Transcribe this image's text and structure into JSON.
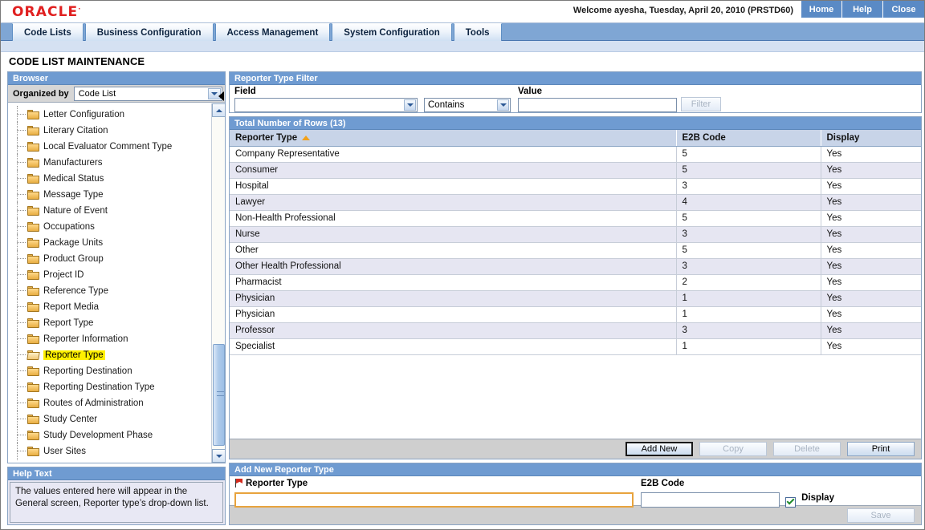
{
  "branding": {
    "logo_text": "ORACLE",
    "trademark": "·"
  },
  "header": {
    "welcome": "Welcome ayesha, Tuesday, April 20, 2010 (PRSTD60)",
    "nav_buttons": [
      {
        "label": "Home",
        "name": "home-link"
      },
      {
        "label": "Help",
        "name": "help-link"
      },
      {
        "label": "Close",
        "name": "close-link"
      }
    ]
  },
  "tabs": [
    {
      "label": "Code Lists",
      "active": true
    },
    {
      "label": "Business Configuration",
      "active": false
    },
    {
      "label": "Access Management",
      "active": false
    },
    {
      "label": "System Configuration",
      "active": false
    },
    {
      "label": "Tools",
      "active": false
    }
  ],
  "page_title": "CODE LIST MAINTENANCE",
  "browser": {
    "panel_title": "Browser",
    "organized_by_label": "Organized by",
    "organized_by_value": "Code List",
    "tree_items": [
      {
        "label": "Letter Configuration",
        "selected": false
      },
      {
        "label": "Literary Citation",
        "selected": false
      },
      {
        "label": "Local Evaluator Comment Type",
        "selected": false
      },
      {
        "label": "Manufacturers",
        "selected": false
      },
      {
        "label": "Medical Status",
        "selected": false
      },
      {
        "label": "Message Type",
        "selected": false
      },
      {
        "label": "Nature of Event",
        "selected": false
      },
      {
        "label": "Occupations",
        "selected": false
      },
      {
        "label": "Package Units",
        "selected": false
      },
      {
        "label": "Product Group",
        "selected": false
      },
      {
        "label": "Project ID",
        "selected": false
      },
      {
        "label": "Reference Type",
        "selected": false
      },
      {
        "label": "Report Media",
        "selected": false
      },
      {
        "label": "Report Type",
        "selected": false
      },
      {
        "label": "Reporter Information",
        "selected": false
      },
      {
        "label": "Reporter Type",
        "selected": true
      },
      {
        "label": "Reporting Destination",
        "selected": false
      },
      {
        "label": "Reporting Destination Type",
        "selected": false
      },
      {
        "label": "Routes of Administration",
        "selected": false
      },
      {
        "label": "Study Center",
        "selected": false
      },
      {
        "label": "Study Development Phase",
        "selected": false
      },
      {
        "label": "User Sites",
        "selected": false
      }
    ]
  },
  "help": {
    "panel_title": "Help Text",
    "text": "The values entered here will appear in the General screen, Reporter type’s drop-down list."
  },
  "filter": {
    "panel_title": "Reporter Type Filter",
    "field_label": "Field",
    "field_value": "",
    "operator_value": "Contains",
    "value_label": "Value",
    "value_text": "",
    "filter_button": "Filter",
    "filter_button_disabled": true
  },
  "grid": {
    "panel_title": "Total Number of Rows (13)",
    "row_count": 13,
    "columns": [
      "Reporter Type",
      "E2B Code",
      "Display"
    ],
    "sort_column": "Reporter Type",
    "sort_direction": "asc",
    "rows": [
      {
        "reporter_type": "Company Representative",
        "e2b_code": "5",
        "display": "Yes"
      },
      {
        "reporter_type": "Consumer",
        "e2b_code": "5",
        "display": "Yes"
      },
      {
        "reporter_type": "Hospital",
        "e2b_code": "3",
        "display": "Yes"
      },
      {
        "reporter_type": "Lawyer",
        "e2b_code": "4",
        "display": "Yes"
      },
      {
        "reporter_type": "Non-Health Professional",
        "e2b_code": "5",
        "display": "Yes"
      },
      {
        "reporter_type": "Nurse",
        "e2b_code": "3",
        "display": "Yes"
      },
      {
        "reporter_type": "Other",
        "e2b_code": "5",
        "display": "Yes"
      },
      {
        "reporter_type": "Other Health Professional",
        "e2b_code": "3",
        "display": "Yes"
      },
      {
        "reporter_type": "Pharmacist",
        "e2b_code": "2",
        "display": "Yes"
      },
      {
        "reporter_type": "Physician",
        "e2b_code": "1",
        "display": "Yes"
      },
      {
        "reporter_type": "Physician",
        "e2b_code": "1",
        "display": "Yes"
      },
      {
        "reporter_type": "Professor",
        "e2b_code": "3",
        "display": "Yes"
      },
      {
        "reporter_type": "Specialist",
        "e2b_code": "1",
        "display": "Yes"
      }
    ],
    "buttons": [
      {
        "label": "Add New",
        "disabled": false,
        "focused": true
      },
      {
        "label": "Copy",
        "disabled": true,
        "focused": false
      },
      {
        "label": "Delete",
        "disabled": true,
        "focused": false
      },
      {
        "label": "Print",
        "disabled": false,
        "focused": false
      }
    ]
  },
  "add_new": {
    "panel_title": "Add New Reporter Type",
    "reporter_type_label": "Reporter Type",
    "reporter_type_value": "",
    "e2b_code_label": "E2B Code",
    "e2b_code_value": "",
    "display_label": "Display",
    "display_checked": true,
    "save_button": "Save",
    "save_button_disabled": true
  },
  "colors": {
    "oracle_red": "#e02020",
    "panel_header_blue": "#6f9bd1",
    "nav_bar_blue": "#5a8ac5",
    "column_header": "#c8d4e8",
    "row_alt": "#e6e6f2",
    "selection_highlight": "#fff000",
    "sort_arrow": "#f2a11a",
    "focus_border": "#e8a33d",
    "check_green": "#1f8a2a"
  }
}
